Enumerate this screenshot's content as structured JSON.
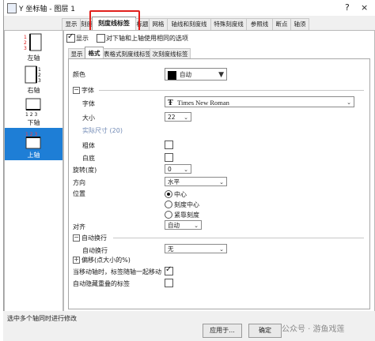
{
  "window": {
    "title": "Y 坐标轴 - 图层 1",
    "help": "?",
    "close": "×"
  },
  "tabs": [
    {
      "label": "显示",
      "active": false
    },
    {
      "label": "刻度",
      "active": false
    },
    {
      "label": "刻度线标签",
      "active": true
    },
    {
      "label": "标题",
      "active": false
    },
    {
      "label": "网格",
      "active": false
    },
    {
      "label": "轴线和刻度线",
      "active": false
    },
    {
      "label": "特殊刻度线",
      "active": false
    },
    {
      "label": "参照线",
      "active": false
    },
    {
      "label": "断点",
      "active": false
    },
    {
      "label": "轴须",
      "active": false
    }
  ],
  "axes": [
    {
      "label": "左轴",
      "icon": "left-axis-icon",
      "selected": false
    },
    {
      "label": "右轴",
      "icon": "right-axis-icon",
      "selected": false
    },
    {
      "label": "下轴",
      "icon": "bottom-axis-icon",
      "selected": false
    },
    {
      "label": "上轴",
      "icon": "top-axis-icon",
      "selected": true
    }
  ],
  "top": {
    "show_label": "显示",
    "show_checked": true,
    "same_option_label": "对下轴和上轴使用相同的选项",
    "same_checked": false
  },
  "subtabs": [
    {
      "label": "显示",
      "active": false
    },
    {
      "label": "格式",
      "active": true
    },
    {
      "label": "表格式刻度线标签",
      "active": false
    },
    {
      "label": "次刻度线标签",
      "active": false
    }
  ],
  "format": {
    "color_label": "颜色",
    "color_value": "自动",
    "color_swatch": "#000000",
    "font_group": "字体",
    "font_label": "字体",
    "font_icon": "Ŧ",
    "font_value": "Times New Roman",
    "size_label": "大小",
    "size_value": "22",
    "actual_size": "实际尺寸 (20)",
    "bold_label": "粗体",
    "white_label": "白底",
    "rotate_label": "旋转(度)",
    "rotate_value": "0",
    "direction_label": "方向",
    "direction_value": "水平",
    "position_label": "位置",
    "position_options": [
      {
        "label": "中心",
        "selected": true
      },
      {
        "label": "刻度中心",
        "selected": false
      },
      {
        "label": "紧靠刻度",
        "selected": false
      }
    ],
    "align_label": "对齐",
    "align_value": "自动",
    "wrap_group": "自动换行",
    "wrap_label": "自动换行",
    "wrap_value": "无",
    "offset_group": "偏移(点大小的%)",
    "move_label": "当移动轴时，标签随轴一起移动",
    "move_checked": true,
    "hide_label": "自动隐藏重叠的标签",
    "hide_checked": false
  },
  "status": {
    "text": "选中多个轴同时进行修改",
    "apply_button": "应用于...",
    "ok_button": "确定"
  },
  "watermark": {
    "text": "公众号 · 游鱼戏莲"
  }
}
